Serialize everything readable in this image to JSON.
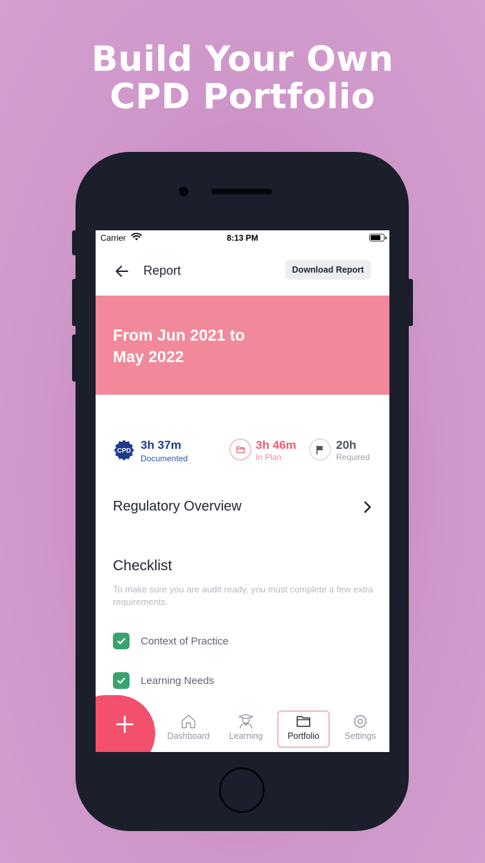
{
  "headline": {
    "line1": "Build Your Own",
    "line2": "CPD Portfolio"
  },
  "status_bar": {
    "carrier": "Carrier",
    "time": "8:13 PM"
  },
  "nav": {
    "title": "Report",
    "download_label": "Download Report"
  },
  "banner": {
    "line1": "From Jun 2021 to",
    "line2": "May 2022"
  },
  "stats": {
    "badge_text": "CPD",
    "documented": {
      "value": "3h 37m",
      "label": "Documented"
    },
    "in_plan": {
      "value": "3h 46m",
      "label": "In Plan"
    },
    "required": {
      "value": "20h",
      "label": "Required"
    }
  },
  "regulatory": {
    "label": "Regulatory Overview"
  },
  "checklist": {
    "title": "Checklist",
    "description": "To make sure you are audit ready, you must complete a few extra requirements.",
    "items": [
      {
        "label": "Context of Practice",
        "checked": true
      },
      {
        "label": "Learning Needs",
        "checked": true
      }
    ]
  },
  "tabs": [
    {
      "label": "Dashboard",
      "icon": "home-icon"
    },
    {
      "label": "Learning",
      "icon": "graduate-icon"
    },
    {
      "label": "Portfolio",
      "icon": "folder-icon",
      "active": true
    },
    {
      "label": "Settings",
      "icon": "gear-icon"
    }
  ],
  "colors": {
    "background": "#cf97ca",
    "banner": "#f2899a",
    "fab": "#f2506c",
    "documented": "#1e3a8a",
    "in_plan": "#f05d75",
    "check": "#3aa26f"
  }
}
